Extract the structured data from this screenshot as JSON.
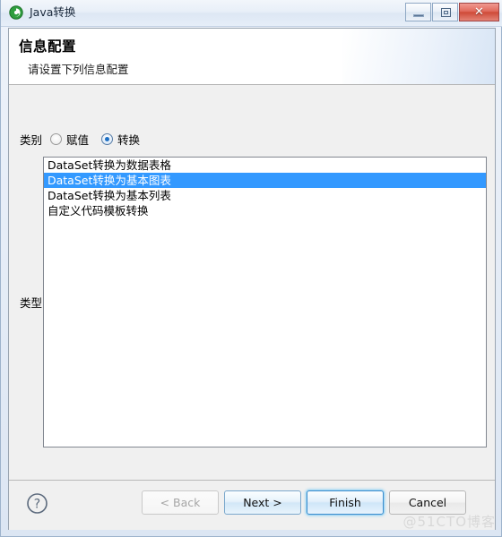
{
  "window": {
    "title": "Java转换",
    "app_icon": "eclipse-green-circle-icon",
    "controls": {
      "minimize": "—",
      "maximize": "❐",
      "close": "✕"
    }
  },
  "header": {
    "title": "信息配置",
    "subtitle": "请设置下列信息配置"
  },
  "category": {
    "label": "类别",
    "options": [
      {
        "label": "赋值",
        "checked": false
      },
      {
        "label": "转换",
        "checked": true
      }
    ]
  },
  "type": {
    "label": "类型",
    "items": [
      {
        "label": "DataSet转换为数据表格",
        "selected": false
      },
      {
        "label": "DataSet转换为基本图表",
        "selected": true
      },
      {
        "label": "DataSet转换为基本列表",
        "selected": false
      },
      {
        "label": "自定义代码模板转换",
        "selected": false
      }
    ]
  },
  "footer": {
    "help_icon": "question-mark-circle-icon",
    "buttons": [
      {
        "label": "< Back",
        "state": "disabled"
      },
      {
        "label": "Next >",
        "state": "hover"
      },
      {
        "label": "Finish",
        "state": "default"
      },
      {
        "label": "Cancel",
        "state": "normal"
      }
    ]
  },
  "watermark": "@51CTO博客",
  "colors": {
    "selection_blue": "#3399ff",
    "accent_focus": "#3c8ccc",
    "close_red": "#cf4a38",
    "icon_green": "#39b54a"
  }
}
